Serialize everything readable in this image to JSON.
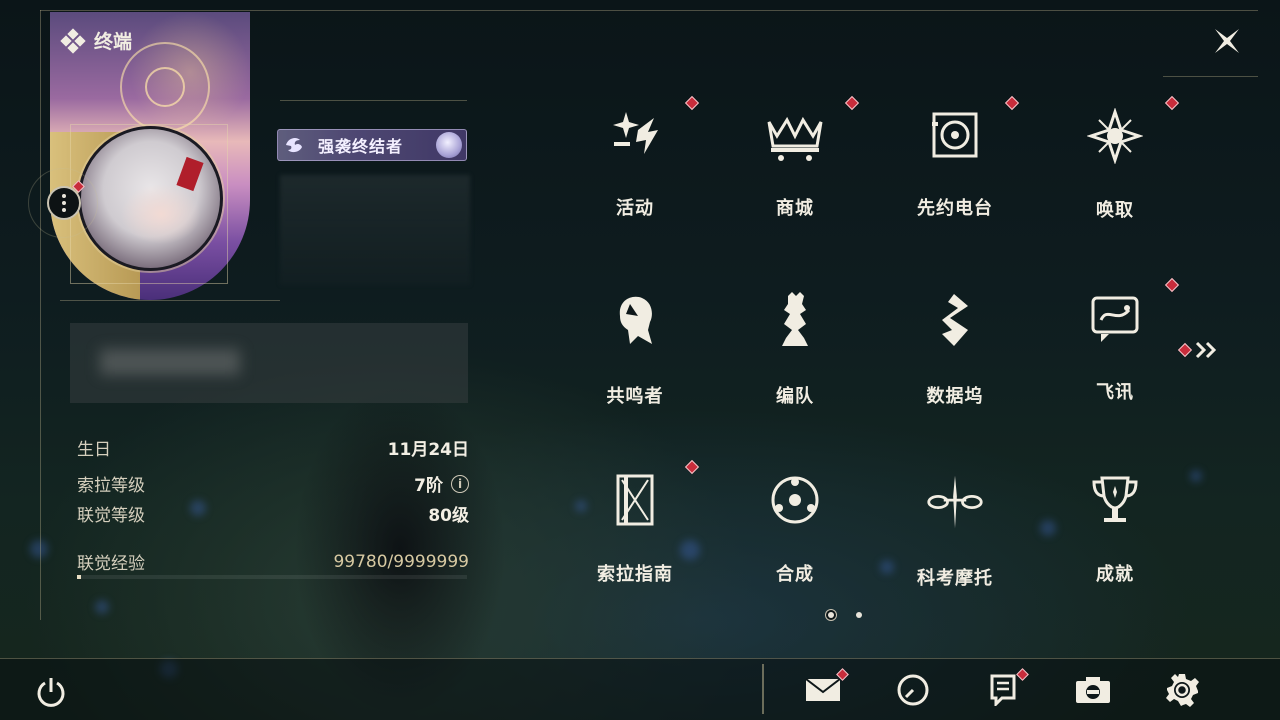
{
  "header": {
    "title": "终端"
  },
  "profile": {
    "title_badge": "强袭终结者",
    "stats": [
      {
        "key": "生日",
        "value": "11月24日"
      },
      {
        "key": "索拉等级",
        "value": "7阶"
      },
      {
        "key": "联觉等级",
        "value": "80级"
      }
    ],
    "exp": {
      "key": "联觉经验",
      "value": "99780/9999999",
      "progress": 0.00998
    }
  },
  "menu": [
    {
      "label": "活动",
      "icon": "sparkle-event-icon",
      "badge": true
    },
    {
      "label": "商城",
      "icon": "shop-cart-icon",
      "badge": true
    },
    {
      "label": "先约电台",
      "icon": "radio-icon",
      "badge": true
    },
    {
      "label": "唤取",
      "icon": "compass-star-icon",
      "badge": true
    },
    {
      "label": "共鸣者",
      "icon": "resonator-head-icon",
      "badge": false
    },
    {
      "label": "编队",
      "icon": "chess-team-icon",
      "badge": false
    },
    {
      "label": "数据坞",
      "icon": "databank-icon",
      "badge": false
    },
    {
      "label": "飞讯",
      "icon": "message-icon",
      "badge": true
    },
    {
      "label": "索拉指南",
      "icon": "guide-book-icon",
      "badge": true
    },
    {
      "label": "合成",
      "icon": "synthesis-icon",
      "badge": false
    },
    {
      "label": "科考摩托",
      "icon": "motorcycle-icon",
      "badge": false
    },
    {
      "label": "成就",
      "icon": "trophy-icon",
      "badge": false
    }
  ],
  "pager": {
    "pages": 2,
    "current": 1
  },
  "bottom_bar": [
    {
      "name": "mail",
      "icon": "mail-icon",
      "badge": true
    },
    {
      "name": "history",
      "icon": "clock-icon",
      "badge": false
    },
    {
      "name": "notice",
      "icon": "notice-icon",
      "badge": true
    },
    {
      "name": "camera",
      "icon": "camera-icon",
      "badge": false
    },
    {
      "name": "settings",
      "icon": "gear-icon",
      "badge": false
    }
  ]
}
